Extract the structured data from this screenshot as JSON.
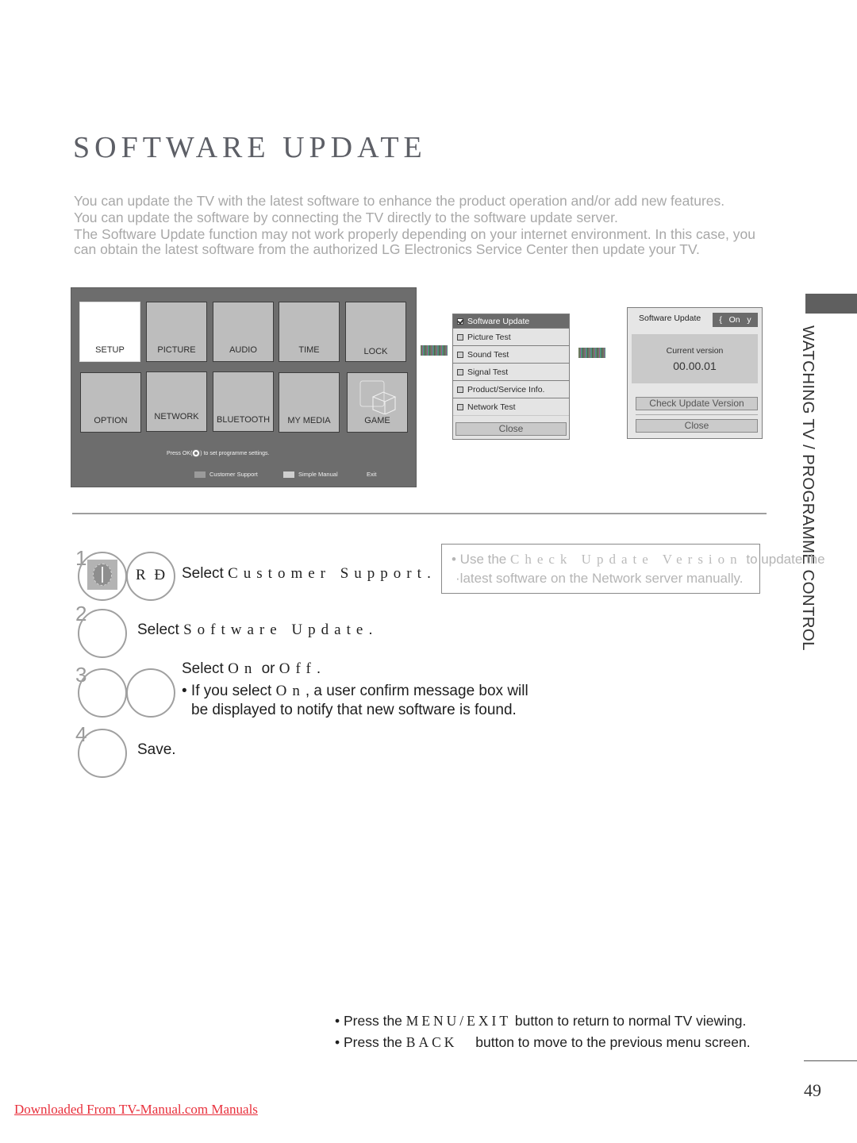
{
  "page": {
    "title": "SOFTWARE UPDATE",
    "section_tab": "WATCHING TV / PROGRAMME CONTROL",
    "page_number": "49",
    "download_link": "Downloaded From TV-Manual.com Manuals"
  },
  "intro": [
    "You can update the TV with the latest software to enhance the product operation and/or add new features.",
    "You can update the software by connecting the TV directly to the software update server.",
    "The Software Update function may not work properly depending on your internet environment. In this case, you can obtain the latest software from the authorized LG Electronics Service Center then update your TV."
  ],
  "tv_menu": {
    "tiles": [
      {
        "label": "SETUP",
        "selected": true
      },
      {
        "label": "PICTURE"
      },
      {
        "label": "AUDIO"
      },
      {
        "label": "TIME"
      },
      {
        "label": "LOCK"
      },
      {
        "label": "OPTION"
      },
      {
        "label": "NETWORK"
      },
      {
        "label": "BLUETOOTH"
      },
      {
        "label": "MY MEDIA"
      },
      {
        "label": "GAME",
        "icon": "game-cubes-icon"
      }
    ],
    "hint_pre": "Press OK(",
    "hint_post": ") to set programme settings.",
    "footer": {
      "customer_support": "Customer Support",
      "simple_manual": "Simple Manual",
      "exit": "Exit"
    },
    "colors": {
      "background": "#6d6d6d",
      "tile": "#bdbdbd",
      "tile_selected": "#ffffff"
    }
  },
  "customer_support_panel": {
    "items": [
      {
        "label": "Software Update",
        "checked": true
      },
      {
        "label": "Picture Test",
        "checked": false
      },
      {
        "label": "Sound Test",
        "checked": false
      },
      {
        "label": "Signal Test",
        "checked": false
      },
      {
        "label": "Product/Service Info.",
        "checked": false
      },
      {
        "label": "Network Test",
        "checked": false
      }
    ],
    "close_label": "Close"
  },
  "software_update_panel": {
    "label": "Software Update",
    "toggle_value": "{   On   y",
    "current_version_label": "Current version",
    "current_version": "00.00.01",
    "check_button": "Check Update Version",
    "close_button": "Close"
  },
  "steps": [
    {
      "number": "1",
      "button": "R Ð",
      "prefix": "Select ",
      "keyword": "Customer Support",
      "suffix": "."
    },
    {
      "number": "2",
      "prefix": "Select ",
      "keyword": "Software Update",
      "suffix": "."
    },
    {
      "number": "3",
      "prefix": "Select ",
      "keyword_on": "On",
      "middle": " or ",
      "keyword_off": "Off",
      "suffix": ".",
      "bullet_prefix": "• If you select ",
      "bullet_keyword": "On",
      "bullet_suffix": ", a user confirm message box will",
      "bullet_line2": "be displayed to notify that new software is found."
    },
    {
      "number": "4",
      "text": "Save."
    }
  ],
  "tip": {
    "prefix": "• Use the ",
    "keyword": "Check Update Version",
    "suffix": " to update the",
    "line2": "latest software on the Network server manually."
  },
  "notes": [
    {
      "prefix": "• Press the ",
      "keyword": "MENU/EXIT",
      "suffix": " button to return to normal TV viewing."
    },
    {
      "prefix": "• Press the ",
      "keyword": "BACK",
      "suffix": " button to move to the previous menu screen."
    }
  ]
}
